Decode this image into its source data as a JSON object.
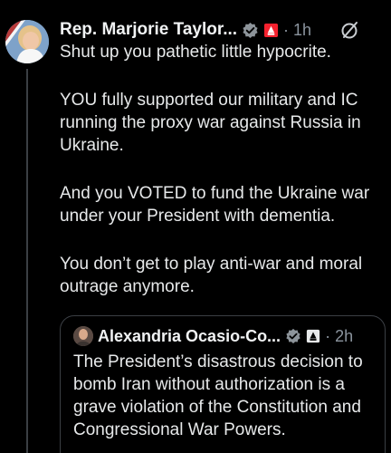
{
  "tweet": {
    "author_name": "Rep. Marjorie Taylor...",
    "timestamp": "1h",
    "separator": "·",
    "paragraphs": [
      "Shut up you pathetic little hypocrite.",
      "YOU fully supported our military and IC running the proxy war against Russia in Ukraine.",
      "And you VOTED to fund the Ukraine war under your President with dementia.",
      "You don’t get to play anti-war and moral outrage anymore."
    ]
  },
  "quoted_tweet": {
    "author_name": "Alexandria Ocasio-Co...",
    "timestamp": "2h",
    "separator": "·",
    "text": "The President’s disastrous decision to bomb Iran without authorization is a grave violation of the Constitution and Congressional War Powers."
  },
  "colors": {
    "background": "#000000",
    "text": "#e7e9ea",
    "muted": "#8b949e",
    "verified_badge": "#8d949a",
    "affiliation_badge": "#f4212e",
    "border": "#3b3f44"
  },
  "icons": {
    "verified": "verified-badge-icon",
    "affiliation": "government-affiliation-icon",
    "more": "grok-icon"
  }
}
